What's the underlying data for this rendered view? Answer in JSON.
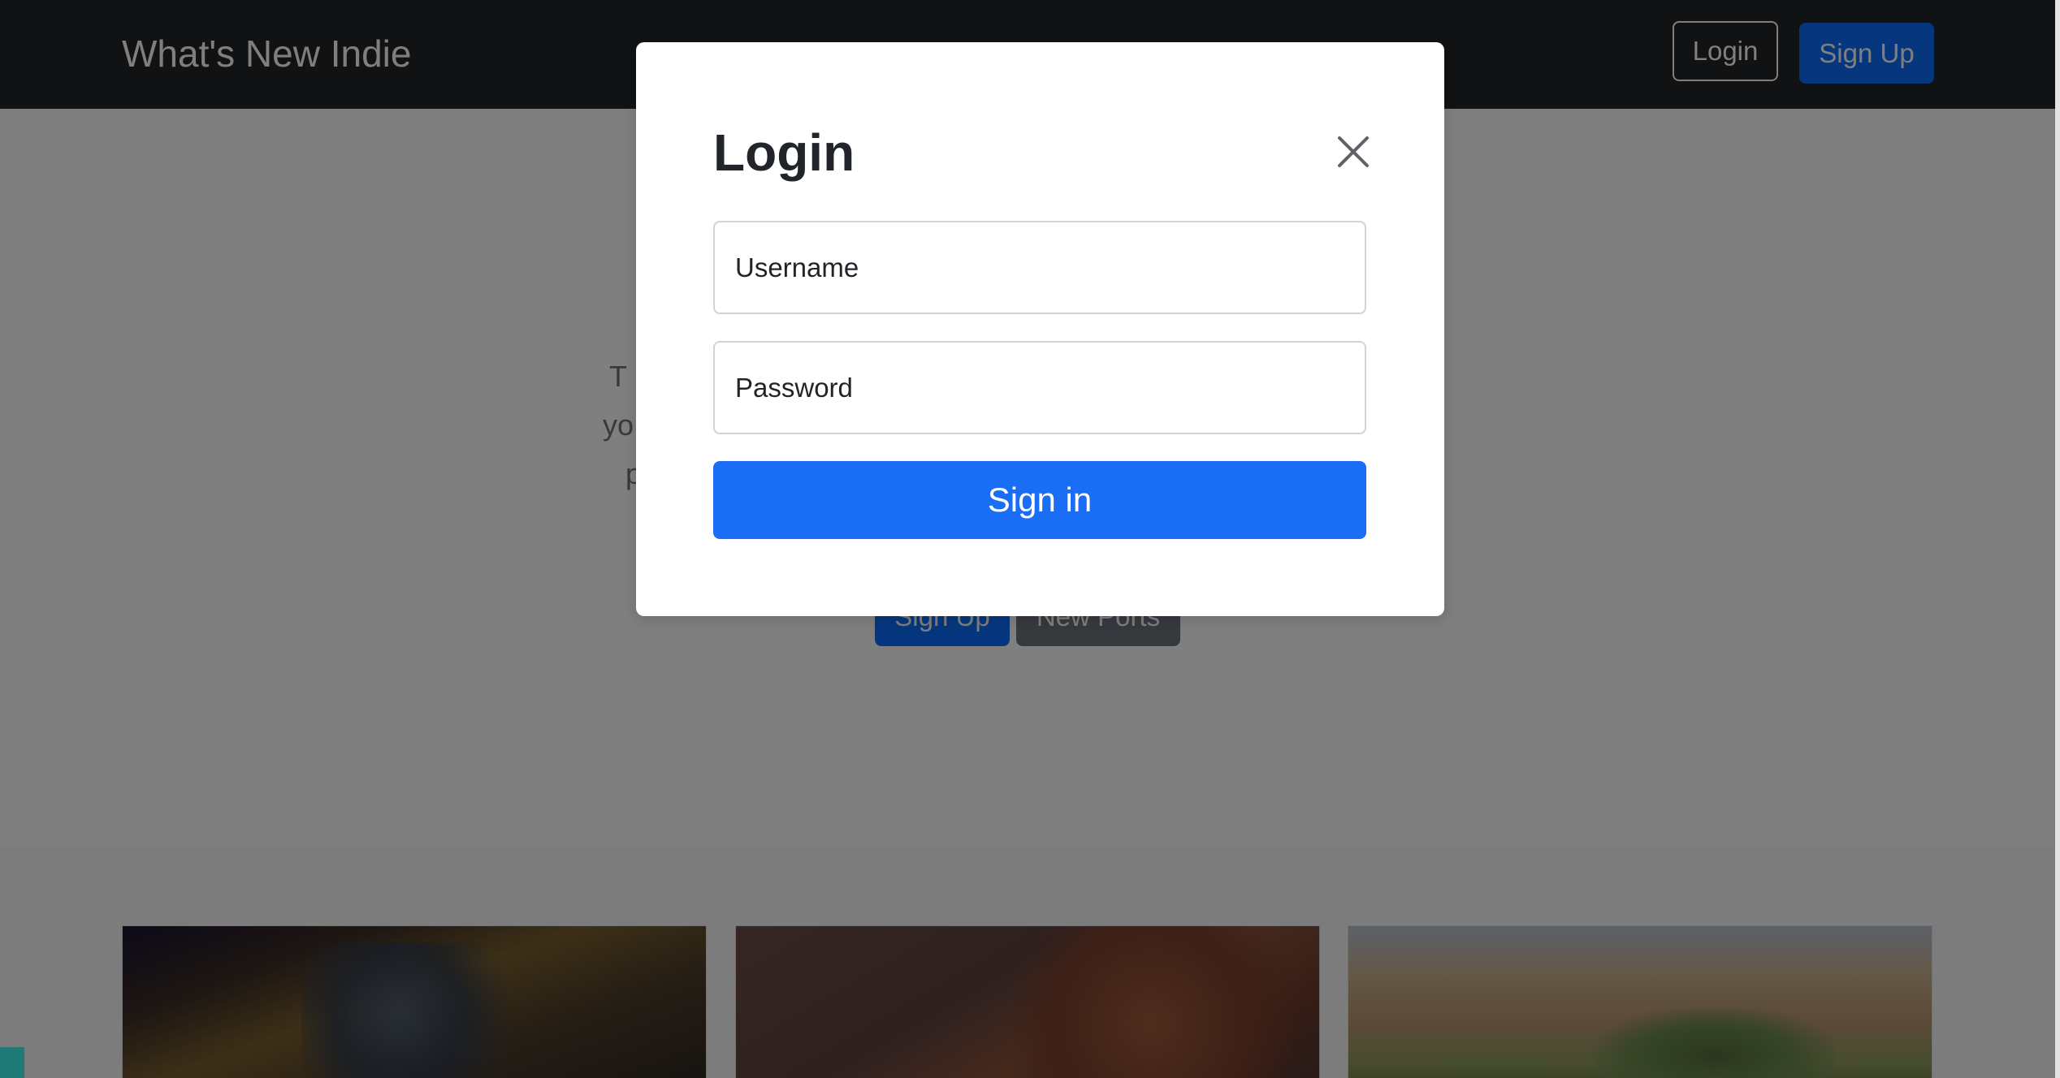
{
  "navbar": {
    "brand": "What's New Indie",
    "login_label": "Login",
    "signup_label": "Sign Up"
  },
  "hero": {
    "text_fragments": [
      "T",
      "yo",
      "p"
    ],
    "signup_label": "Sign Up",
    "new_ports_label": "New Ports"
  },
  "modal": {
    "title": "Login",
    "username_placeholder": "Username",
    "password_placeholder": "Password",
    "signin_label": "Sign in"
  },
  "colors": {
    "navbar_bg": "#212529",
    "primary": "#0d6efd",
    "secondary": "#6c757d"
  },
  "icons": {
    "close": "close-icon"
  }
}
